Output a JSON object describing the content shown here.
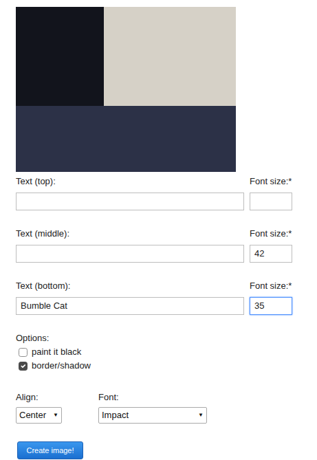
{
  "fields": [
    {
      "label": "Text (top):",
      "value": "",
      "size_label": "Font size:*",
      "size": "",
      "focused": false
    },
    {
      "label": "Text (middle):",
      "value": "",
      "size_label": "Font size:*",
      "size": "42",
      "focused": false
    },
    {
      "label": "Text (bottom):",
      "value": "Bumble Cat",
      "size_label": "Font size:*",
      "size": "35",
      "focused": true
    }
  ],
  "options": {
    "label": "Options:",
    "items": [
      {
        "label": "paint it black",
        "checked": false
      },
      {
        "label": "border/shadow",
        "checked": true
      }
    ]
  },
  "align": {
    "label": "Align:",
    "value": "Center",
    "arrow": "▼"
  },
  "font": {
    "label": "Font:",
    "value": "Impact",
    "arrow": "▼"
  },
  "button": "Create image!"
}
